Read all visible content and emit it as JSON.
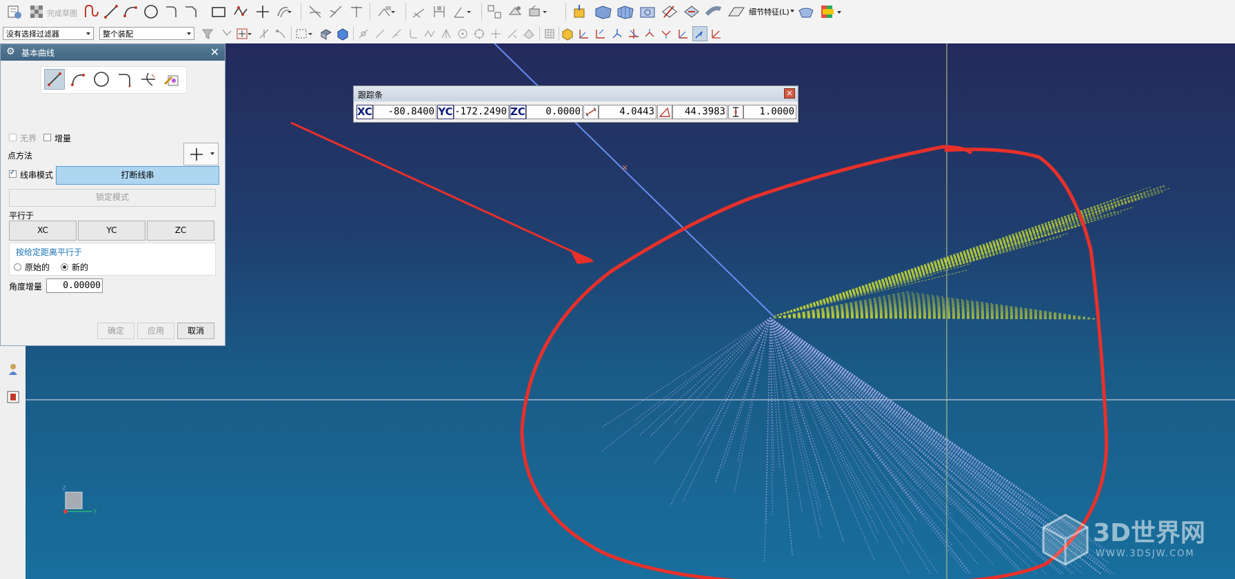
{
  "toolbar": {
    "finish_sketch_label": "完成草图",
    "detail_feature_label": "细节特征(L)",
    "selection_filter_value": "没有选择过滤器",
    "assembly_scope_value": "整个装配"
  },
  "dialog": {
    "title": "基本曲线",
    "tools": [
      "line-tool",
      "arc-tool",
      "circle-tool",
      "fillet-tool",
      "trim-tool",
      "edit-curve-parameters-tool"
    ],
    "infinite_label": "无界",
    "infinite_checked": false,
    "increment_label": "增量",
    "increment_checked": false,
    "point_method_label": "点方法",
    "string_mode_label": "线串模式",
    "string_mode_checked": true,
    "break_string_label": "打断线串",
    "lock_mode_label": "锁定模式",
    "parallel_to_label": "平行于",
    "xc_label": "XC",
    "yc_label": "YC",
    "zc_label": "ZC",
    "parallel_distance_label": "按给定距离平行于",
    "original_label": "原始的",
    "new_label": "新的",
    "selected_option": "新的",
    "angle_increment_label": "角度增量",
    "angle_increment_value": "0.00000",
    "ok_label": "确定",
    "apply_label": "应用",
    "cancel_label": "取消"
  },
  "trackbar": {
    "title": "跟踪条",
    "xc_label": "XC",
    "xc_value": "-80.8400",
    "yc_label": "YC",
    "yc_value": "-172.2490",
    "zc_label": "ZC",
    "zc_value": "0.0000",
    "length_value": "4.0443",
    "angle_value": "44.3983",
    "offset_value": "1.0000"
  },
  "triad": {
    "z_label": "Z",
    "y_label": "Y"
  },
  "watermark": {
    "brand": "3D世界网",
    "url": "WWW.3DSJW.COM"
  },
  "colors": {
    "viewport_top": "#242a5c",
    "viewport_bottom": "#186f9d",
    "annotation_red": "#e8302a",
    "curve_blue": "#6a8ef0",
    "yellow_lines": "#b9c93a",
    "purple_lines": "#9aa3e6",
    "crosshair": "#d6d3a8"
  }
}
